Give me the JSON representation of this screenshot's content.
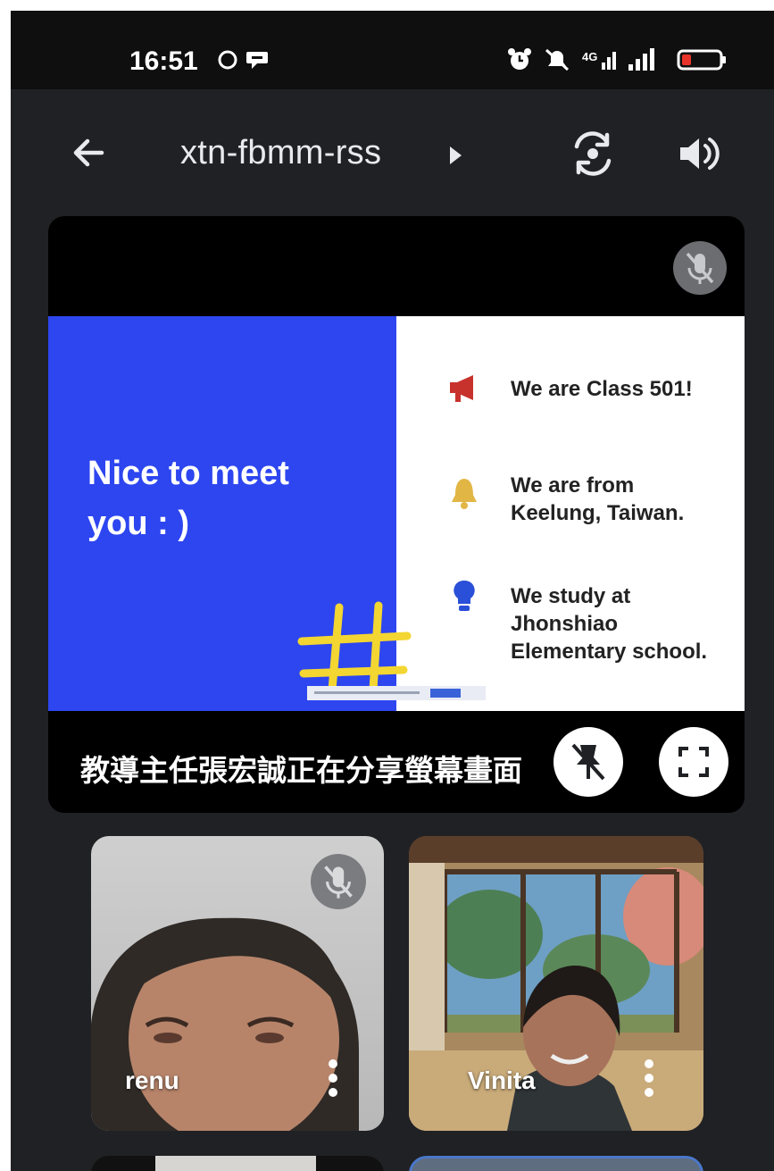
{
  "status_bar": {
    "time": "16:51",
    "icons_left": [
      "chat-bubble-outline-icon",
      "chat-bubble-icon"
    ],
    "icons_right": [
      "alarm-icon",
      "mute-icon",
      "signal-4g-icon",
      "signal-bars-icon",
      "battery-low-icon"
    ]
  },
  "header": {
    "meeting_code": "xtn-fbmm-rss",
    "icons": [
      "back-arrow-icon",
      "switch-camera-icon",
      "speaker-icon"
    ]
  },
  "presentation": {
    "slide": {
      "left_text_line1": "Nice to meet",
      "left_text_line2": "you : )",
      "items": [
        {
          "icon": "megaphone-icon",
          "line1": "We are Class 501!",
          "line2": "",
          "line3": ""
        },
        {
          "icon": "bell-icon",
          "line1": "We are from",
          "line2": "Keelung, Taiwan.",
          "line3": ""
        },
        {
          "icon": "lightbulb-icon",
          "line1": "We study at",
          "line2": "Jhonshiao",
          "line3": "Elementary school."
        }
      ]
    },
    "sharing_text": "教導主任張宏誠正在分享螢幕畫面",
    "colors": {
      "slide_left": "#2d46f0",
      "doodle": "#f3d631"
    }
  },
  "participants": [
    {
      "name": "renu",
      "muted": true
    },
    {
      "name": "Vinita",
      "muted": false
    }
  ],
  "colors": {
    "app_bg": "#202124",
    "status_bar_bg": "#0f0f10"
  }
}
